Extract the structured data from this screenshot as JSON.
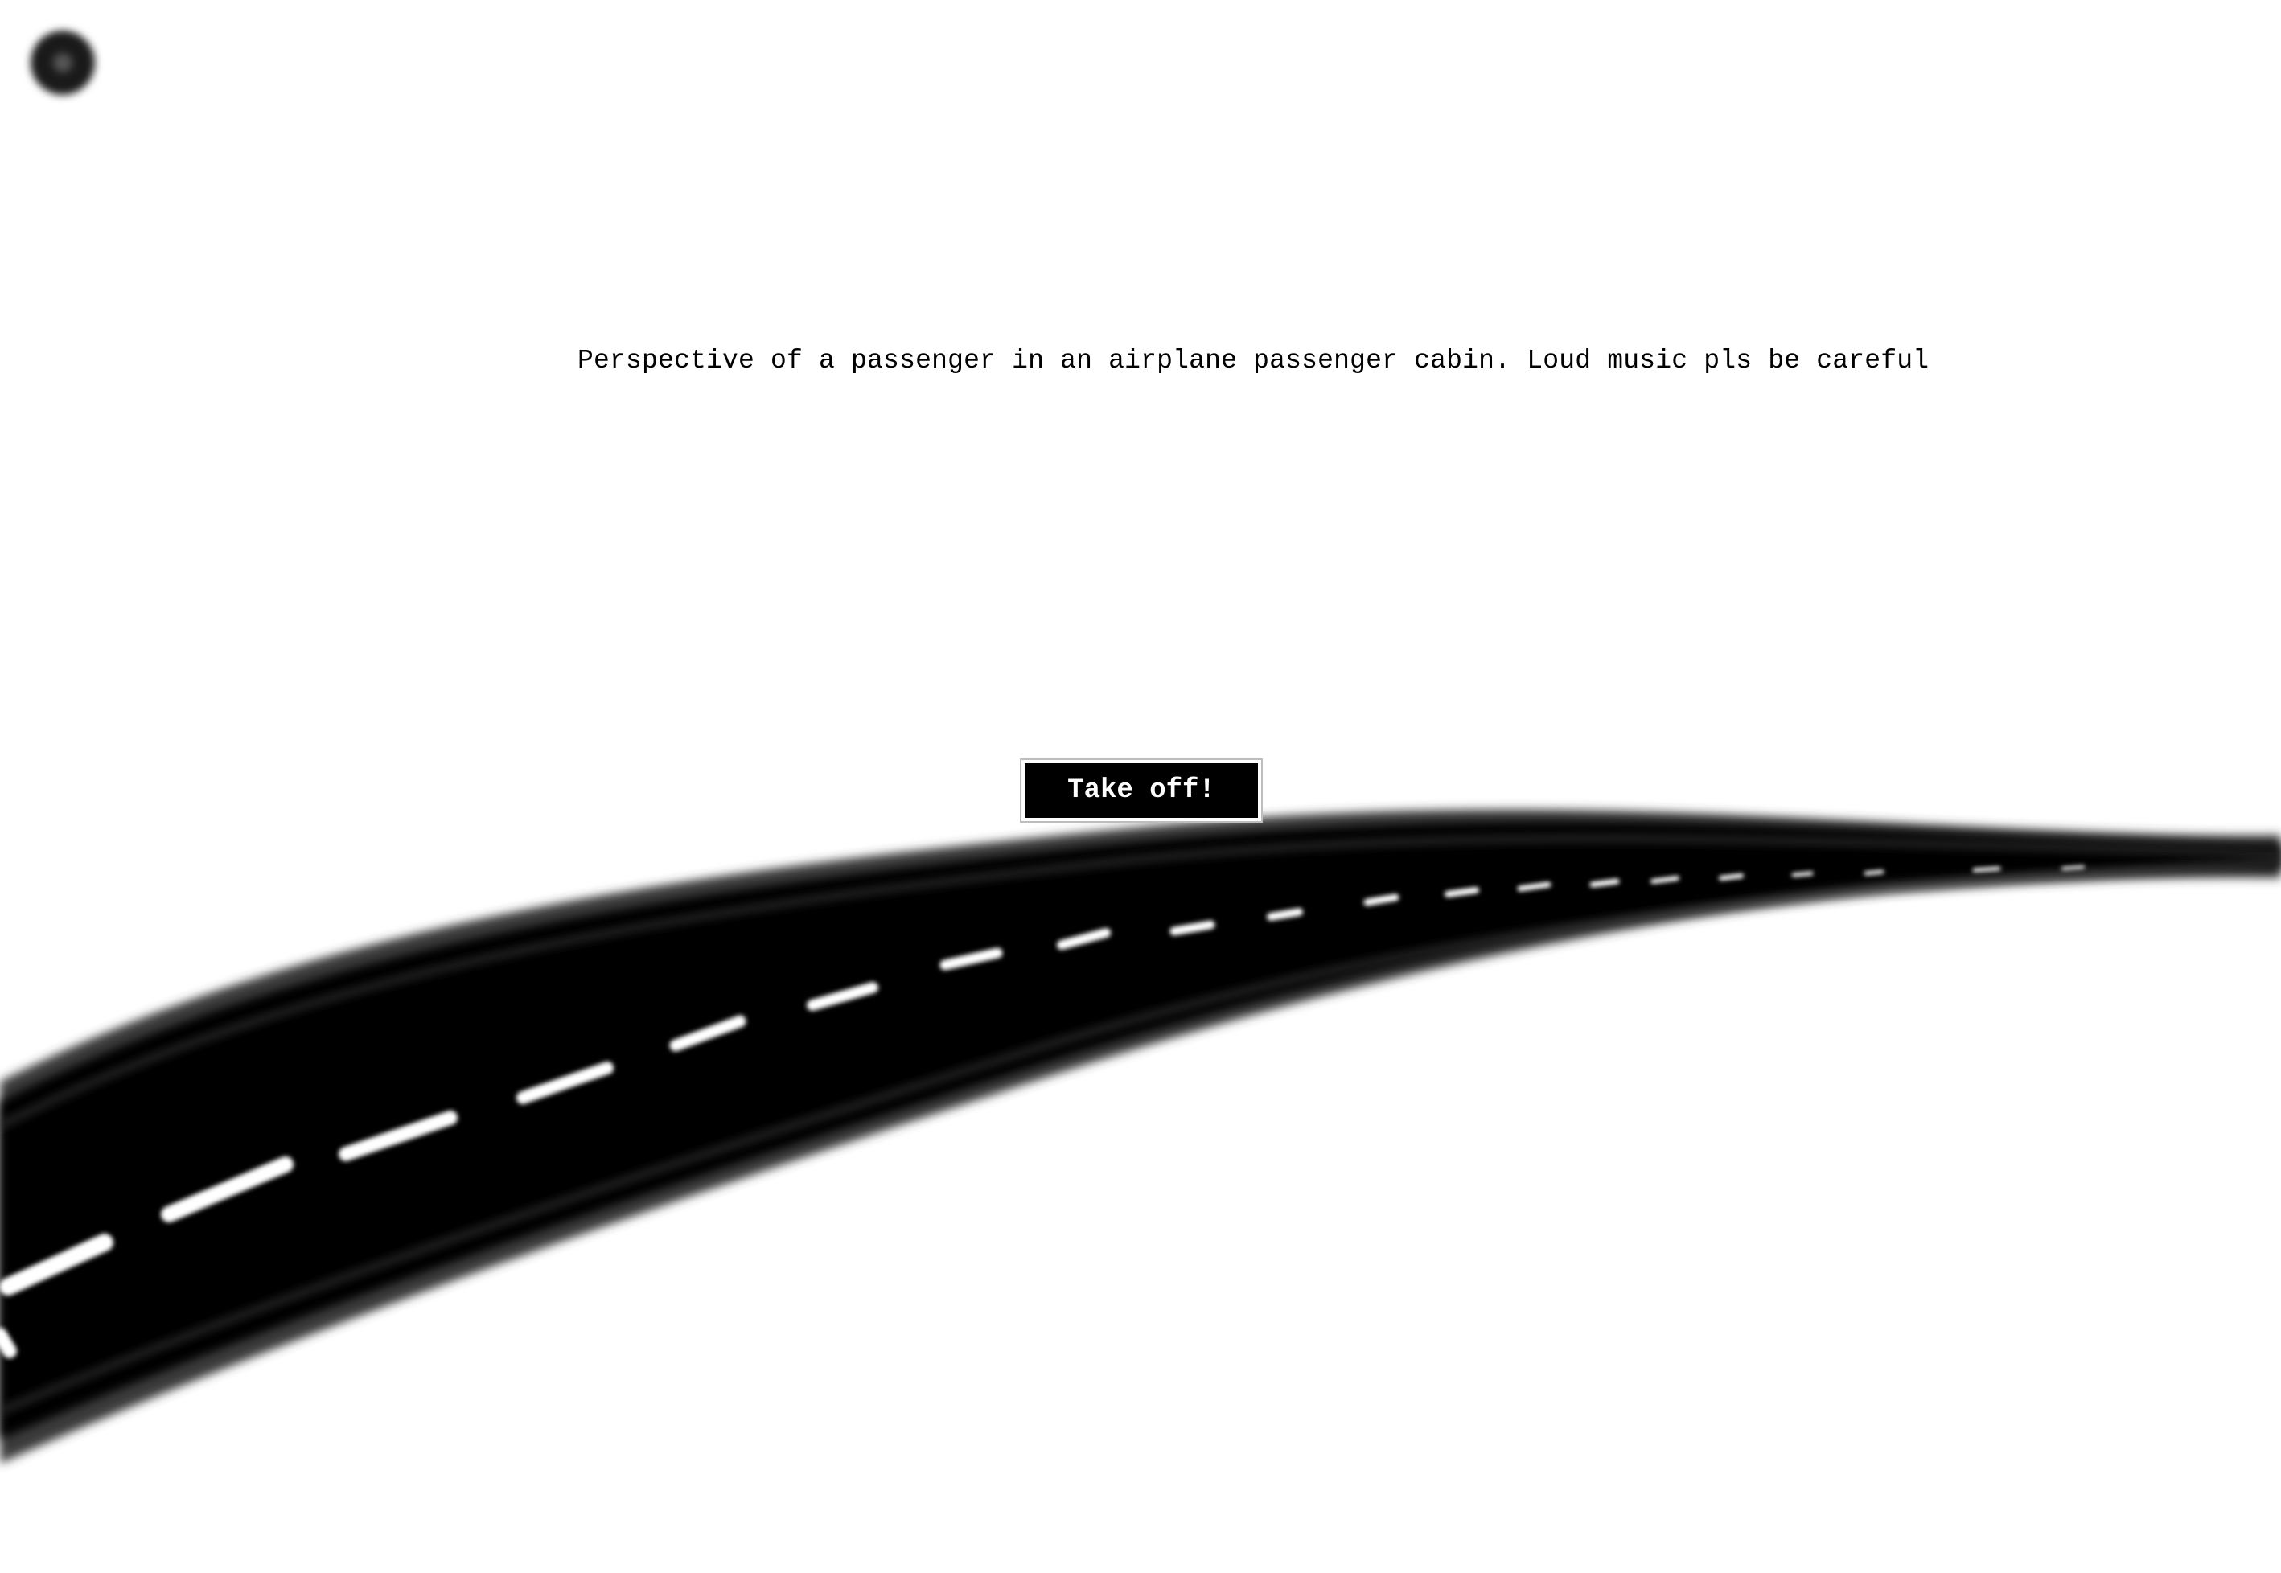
{
  "caption": {
    "text": "Perspective of a passenger in an airplane passenger cabin. Loud music pls be careful"
  },
  "controls": {
    "takeoff_label": "Take off!"
  },
  "icons": {
    "corner_control": "circle-icon",
    "runway": "runway-road-icon"
  },
  "colors": {
    "background": "#ffffff",
    "runway": "#000000",
    "dashes": "#ffffff",
    "button_bg": "#000000",
    "button_text": "#ffffff"
  }
}
